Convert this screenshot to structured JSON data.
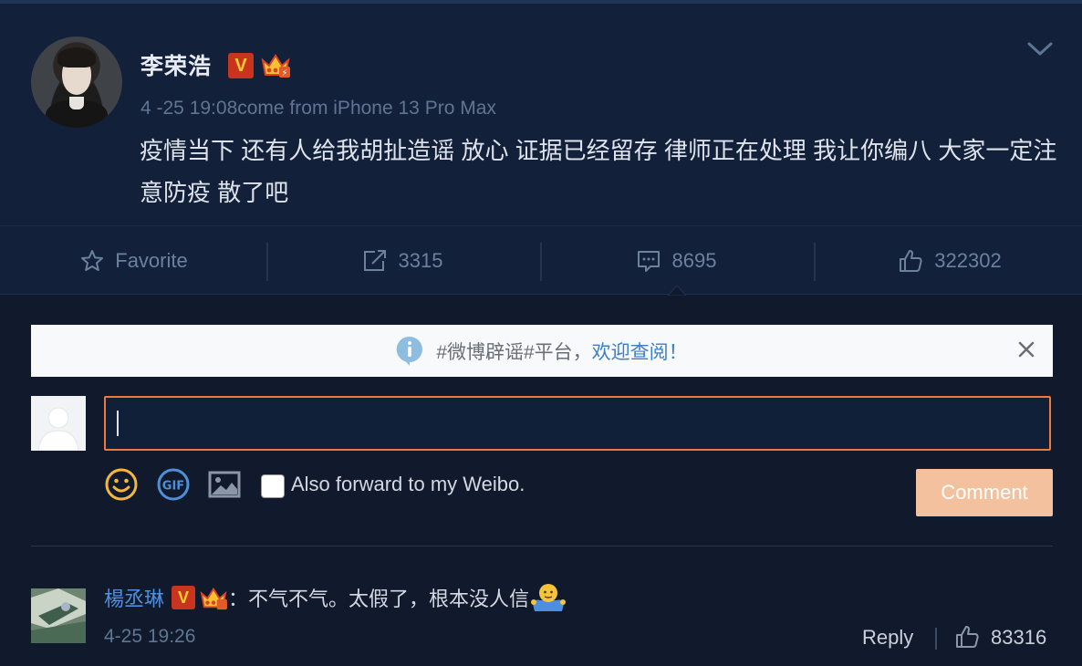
{
  "post": {
    "username": "李荣浩",
    "verified_badge": "V",
    "timestamp": "4 -25 19:08come from iPhone 13 Pro Max",
    "text": "疫情当下 还有人给我胡扯造谣 放心 证据已经留存 律师正在处理 我让你编八 大家一定注意防疫 散了吧"
  },
  "actions": {
    "favorite_label": "Favorite",
    "forward_count": "3315",
    "comment_count": "8695",
    "like_count": "322302"
  },
  "banner": {
    "prefix": "#微博辟谣#平台，",
    "link": "欢迎查阅！"
  },
  "composer": {
    "input_value": "",
    "forward_label": "Also forward to my Weibo.",
    "comment_button": "Comment"
  },
  "comment": {
    "username": "楊丞琳",
    "verified_badge": "V",
    "text": "：不气不气。太假了，根本没人信",
    "time": "4-25 19:26",
    "reply_label": "Reply",
    "likes": "83316"
  },
  "colors": {
    "background": "#101a2c",
    "post_background": "#12203a",
    "accent_orange": "#ef7a3c",
    "link_blue": "#4d8fe0",
    "muted_text": "#5f7591"
  },
  "icons": [
    "chevron-down-icon",
    "star-icon",
    "forward-icon",
    "comment-icon",
    "thumbs-up-icon",
    "info-icon",
    "close-icon",
    "emoji-icon",
    "gif-icon",
    "image-icon",
    "crown-icon"
  ]
}
